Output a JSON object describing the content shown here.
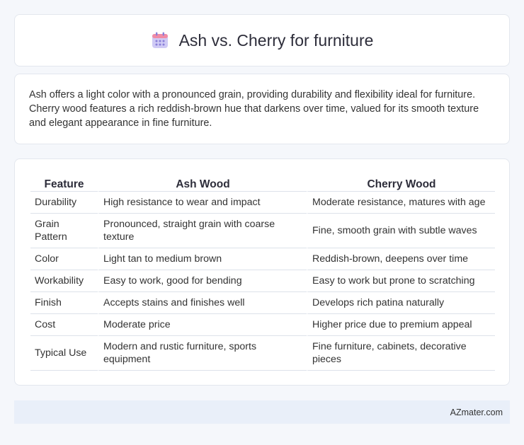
{
  "header": {
    "title": "Ash vs. Cherry for furniture",
    "icon": "calendar-icon",
    "icon_colors": {
      "top": "#f08ba6",
      "body": "#c9c5f2",
      "dots": "#8a7fd8"
    }
  },
  "intro": {
    "text": "Ash offers a light color with a pronounced grain, providing durability and flexibility ideal for furniture. Cherry wood features a rich reddish-brown hue that darkens over time, valued for its smooth texture and elegant appearance in fine furniture."
  },
  "table": {
    "headers": [
      "Feature",
      "Ash Wood",
      "Cherry Wood"
    ],
    "rows": [
      [
        "Durability",
        "High resistance to wear and impact",
        "Moderate resistance, matures with age"
      ],
      [
        "Grain Pattern",
        "Pronounced, straight grain with coarse texture",
        "Fine, smooth grain with subtle waves"
      ],
      [
        "Color",
        "Light tan to medium brown",
        "Reddish-brown, deepens over time"
      ],
      [
        "Workability",
        "Easy to work, good for bending",
        "Easy to work but prone to scratching"
      ],
      [
        "Finish",
        "Accepts stains and finishes well",
        "Develops rich patina naturally"
      ],
      [
        "Cost",
        "Moderate price",
        "Higher price due to premium appeal"
      ],
      [
        "Typical Use",
        "Modern and rustic furniture, sports equipment",
        "Fine furniture, cabinets, decorative pieces"
      ]
    ]
  },
  "footer": {
    "brand": "AZmater.com"
  }
}
